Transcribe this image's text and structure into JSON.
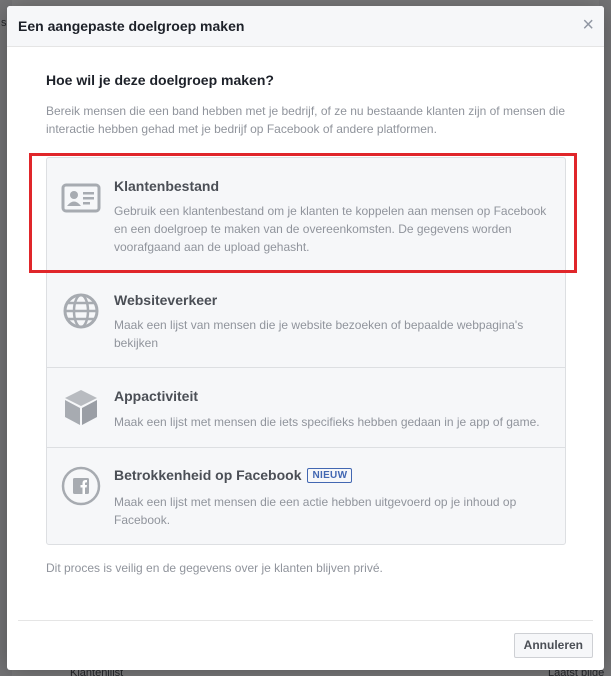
{
  "background": {
    "fragments": [
      "s",
      "Klantenlijst",
      "Laatst bijge"
    ]
  },
  "modal": {
    "title": "Een aangepaste doelgroep maken",
    "close_glyph": "×",
    "question": "Hoe wil je deze doelgroep maken?",
    "intro": "Bereik mensen die een band hebben met je bedrijf, of ze nu bestaande klanten zijn of mensen die interactie hebben gehad met je bedrijf op Facebook of andere platformen.",
    "options": [
      {
        "title": "Klantenbestand",
        "description": "Gebruik een klantenbestand om je klanten te koppelen aan mensen op Facebook en een doelgroep te maken van de overeenkomsten. De gegevens worden voorafgaand aan de upload gehasht.",
        "icon": "contact-card-icon",
        "highlighted": true
      },
      {
        "title": "Websiteverkeer",
        "description": "Maak een lijst van mensen die je website bezoeken of bepaalde webpagina's bekijken",
        "icon": "globe-icon"
      },
      {
        "title": "Appactiviteit",
        "description": "Maak een lijst met mensen die iets specifieks hebben gedaan in je app of game.",
        "icon": "cube-icon"
      },
      {
        "title": "Betrokkenheid op Facebook",
        "badge": "NIEUW",
        "description": "Maak een lijst met mensen die een actie hebben uitgevoerd op je inhoud op Facebook.",
        "icon": "facebook-icon"
      }
    ],
    "footnote": "Dit proces is veilig en de gegevens over je klanten blijven privé.",
    "cancel_label": "Annuleren"
  },
  "colors": {
    "highlight": "#e0262a",
    "badge": "#4267b2",
    "icon_gray": "#a7abb1"
  }
}
